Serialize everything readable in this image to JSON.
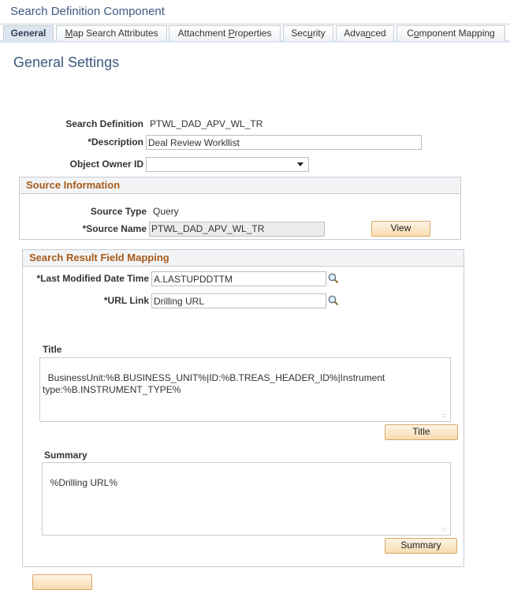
{
  "component_title": "Search Definition Component",
  "tabs": [
    {
      "label": "General",
      "accesskey_char": "",
      "active": true
    },
    {
      "label_pre": "",
      "accesskey": "M",
      "label_post": "ap Search Attributes"
    },
    {
      "label_pre": "Attachment ",
      "accesskey": "P",
      "label_post": "roperties"
    },
    {
      "label_pre": "Sec",
      "accesskey": "u",
      "label_post": "rity"
    },
    {
      "label_pre": "Adva",
      "accesskey": "n",
      "label_post": "ced"
    },
    {
      "label_pre": "C",
      "accesskey": "o",
      "label_post": "mponent Mapping"
    }
  ],
  "page_title": "General Settings",
  "general": {
    "search_definition_label": "Search Definition",
    "search_definition_value": "PTWL_DAD_APV_WL_TR",
    "description_label": "*Description",
    "description_value": "Deal Review Workllist",
    "owner_label": "Object Owner ID",
    "owner_value": ""
  },
  "source": {
    "header": "Source Information",
    "type_label": "Source Type",
    "type_value": "Query",
    "name_label": "*Source Name",
    "name_value": "PTWL_DAD_APV_WL_TR",
    "view_button": "View"
  },
  "mapping": {
    "header": "Search Result Field Mapping",
    "last_modified_label": "*Last Modified Date Time",
    "last_modified_value": "A.LASTUPDDTTM",
    "url_label": "*URL Link",
    "url_value": "Drilling URL",
    "title_label": "Title",
    "title_value": "BusinessUnit:%B.BUSINESS_UNIT%|ID:%B.TREAS_HEADER_ID%|Instrument type:%B.INSTRUMENT_TYPE%",
    "title_button": "Title",
    "summary_label": "Summary",
    "summary_value": "%Drilling URL%",
    "summary_button": "Summary"
  },
  "colors": {
    "title_blue": "#3d5a80",
    "group_header_orange": "#a85a18",
    "button_fill": "#f8dbb1",
    "button_border": "#d9a868"
  }
}
